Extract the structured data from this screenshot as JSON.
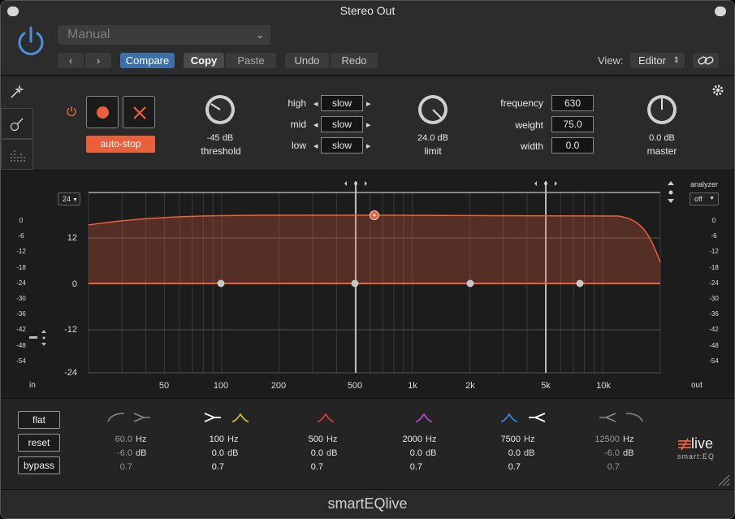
{
  "window": {
    "title": "Stereo Out",
    "footer": "smartEQlive"
  },
  "host": {
    "preset": "Manual",
    "compare": "Compare",
    "copy": "Copy",
    "paste": "Paste",
    "undo": "Undo",
    "redo": "Redo",
    "view_label": "View:",
    "view_value": "Editor"
  },
  "controls": {
    "autostop": "auto-stop",
    "threshold": {
      "value": "-45 dB",
      "label": "threshold"
    },
    "speeds": [
      {
        "label": "high",
        "value": "slow"
      },
      {
        "label": "mid",
        "value": "slow"
      },
      {
        "label": "low",
        "value": "slow"
      }
    ],
    "limit": {
      "value": "24.0 dB",
      "label": "limit"
    },
    "params": [
      {
        "label": "frequency",
        "value": "630"
      },
      {
        "label": "weight",
        "value": "75.0"
      },
      {
        "label": "width",
        "value": "0.0"
      }
    ],
    "master": {
      "value": "0.0 dB",
      "label": "master"
    }
  },
  "graph": {
    "range_select": "24",
    "analyzer_label": "analyzer",
    "analyzer_value": "off",
    "in_label": "in",
    "out_label": "out",
    "gain_labels": [
      "12",
      "0",
      "-12",
      "-24"
    ],
    "meter_labels": [
      "0",
      "-6",
      "-12",
      "-18",
      "-24",
      "-30",
      "-36",
      "-42",
      "-48",
      "-54"
    ],
    "freq_labels": [
      "50",
      "100",
      "200",
      "500",
      "1k",
      "2k",
      "5k",
      "10k"
    ]
  },
  "bands_section": {
    "flat": "flat",
    "reset": "reset",
    "bypass": "bypass",
    "units": {
      "hz": "Hz",
      "db": "dB"
    },
    "bands": [
      {
        "freq": "60.0",
        "gain": "-6.0",
        "q": "0.7",
        "active": false
      },
      {
        "freq": "100",
        "gain": "0.0",
        "q": "0.7",
        "active": true
      },
      {
        "freq": "500",
        "gain": "0.0",
        "q": "0.7",
        "active": true
      },
      {
        "freq": "2000",
        "gain": "0.0",
        "q": "0.7",
        "active": true
      },
      {
        "freq": "7500",
        "gain": "0.0",
        "q": "0.7",
        "active": true
      },
      {
        "freq": "12500",
        "gain": "-6.0",
        "q": "0.7",
        "active": false
      }
    ],
    "logo_top": "live",
    "logo_bottom": "smart:EQ"
  },
  "colors": {
    "accent": "#e8613c",
    "blue": "#3d6fa8",
    "yellow": "#e0c030",
    "red": "#e04040",
    "purple": "#b050d0",
    "lightblue": "#3c8ce0"
  }
}
